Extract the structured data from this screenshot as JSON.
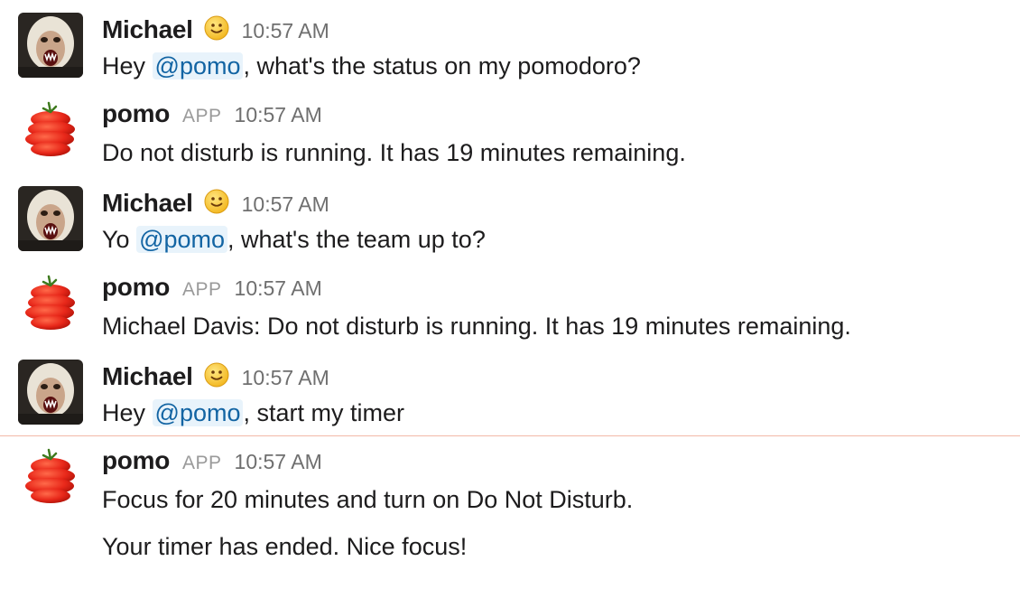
{
  "users": {
    "michael": {
      "name": "Michael",
      "status_emoji": "slightly-smiling-face-icon"
    },
    "pomo": {
      "name": "pomo",
      "badge": "APP"
    }
  },
  "messages": [
    {
      "author": "Michael",
      "time": "10:57 AM",
      "parts": {
        "pre": "Hey ",
        "mention": "@pomo",
        "post": ", what's the status on my pomodoro?"
      }
    },
    {
      "author": "pomo",
      "time": "10:57 AM",
      "lines": [
        "Do not disturb is running. It has 19 minutes remaining."
      ]
    },
    {
      "author": "Michael",
      "time": "10:57 AM",
      "parts": {
        "pre": "Yo ",
        "mention": "@pomo",
        "post": ", what's the team up to?"
      }
    },
    {
      "author": "pomo",
      "time": "10:57 AM",
      "lines": [
        "Michael Davis: Do not disturb is running. It has 19 minutes remaining."
      ]
    },
    {
      "author": "Michael",
      "time": "10:57 AM",
      "parts": {
        "pre": "Hey ",
        "mention": "@pomo",
        "post": ", start my timer"
      }
    },
    {
      "author": "pomo",
      "time": "10:57 AM",
      "lines": [
        "Focus for 20 minutes and turn on Do Not Disturb.",
        "Your timer has ended. Nice focus!"
      ]
    }
  ],
  "colors": {
    "mention_text": "#1264a3",
    "mention_bg": "#e8f3fb",
    "new_messages_divider": "#f2b8a8"
  }
}
